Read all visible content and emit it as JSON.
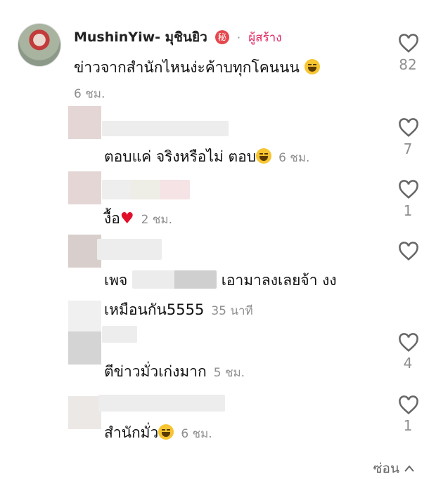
{
  "main_comment": {
    "username": "MushinYiw- มุชินยิว",
    "badge": "秘",
    "creator_label": "ผู้สร้าง",
    "text": "ข่าวจากสำนักไหนง่ะค้าบทุกโคนนน",
    "time": "6 ชม.",
    "likes": "82"
  },
  "replies": [
    {
      "text": "ตอบแค่ จริงหรือไม่ ตอบ",
      "time": "6 ชม.",
      "likes": "7",
      "emoji": "laugh-cry-emoji"
    },
    {
      "text": "งื้อ",
      "time": "2 ชม.",
      "likes": "1",
      "emoji": "red-heart-emoji"
    },
    {
      "text_part1": "เพจ",
      "text_part2": "เอามาลงเลยจ้า งง",
      "text_line2": "เหมือนกัน5555",
      "time": "35 นาที",
      "likes": ""
    },
    {
      "text": "ตีข่าวมั่วเก่งมาก",
      "time": "5 ชม.",
      "likes": "4"
    },
    {
      "text": "สำนักมั่ว",
      "time": "6 ชม.",
      "likes": "1",
      "emoji": "laugh-cry-emoji"
    }
  ],
  "footer": {
    "hide_label": "ซ่อน"
  }
}
